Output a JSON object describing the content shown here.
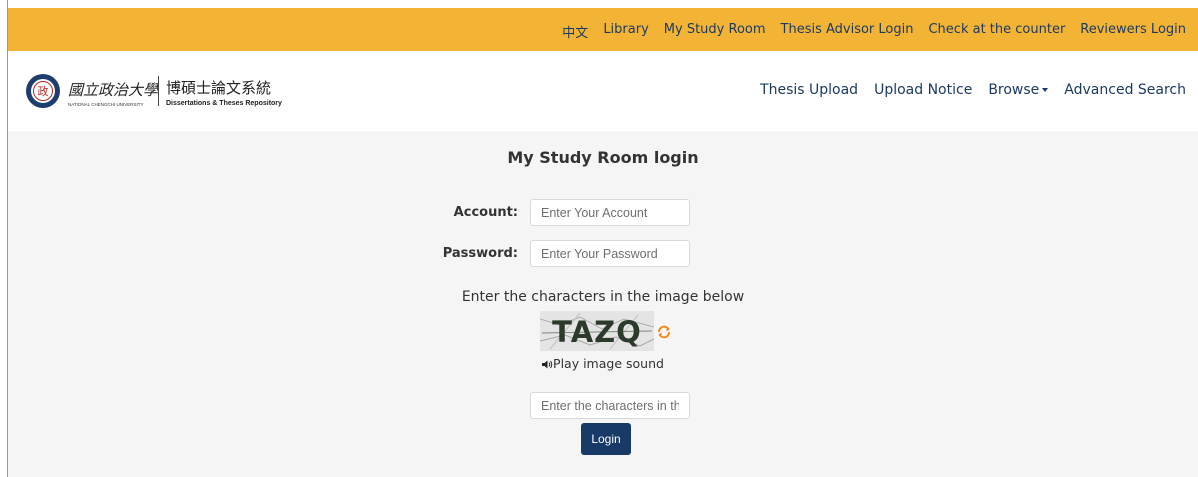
{
  "top_nav": {
    "items": [
      "中文",
      "Library",
      "My Study Room",
      "Thesis Advisor Login",
      "Check at the counter",
      "Reviewers Login"
    ]
  },
  "brand": {
    "seal_char": "政",
    "university_name_zh": "國立政治大學",
    "university_name_en": "NATIONAL CHENGCHI UNIVERSITY",
    "system_name_zh": "博碩士論文系統",
    "system_name_en": "Dissertations & Theses Repository"
  },
  "main_nav": {
    "items": [
      "Thesis Upload",
      "Upload Notice",
      "Browse",
      "Advanced Search"
    ]
  },
  "login": {
    "title": "My Study Room login",
    "account_label": "Account:",
    "account_placeholder": "Enter Your Account",
    "password_label": "Password:",
    "password_placeholder": "Enter Your Password",
    "captcha_prompt": "Enter the characters in the image below",
    "captcha_image_text": "TAZQ",
    "play_sound_label": "Play image sound",
    "captcha_placeholder": "Enter the characters in the image",
    "login_button": "Login"
  },
  "colors": {
    "top_bar": "#f3b436",
    "nav_text": "#1b3a63",
    "login_button": "#173a66",
    "content_bg": "#f5f5f5",
    "refresh_icon": "#f08c1e"
  }
}
